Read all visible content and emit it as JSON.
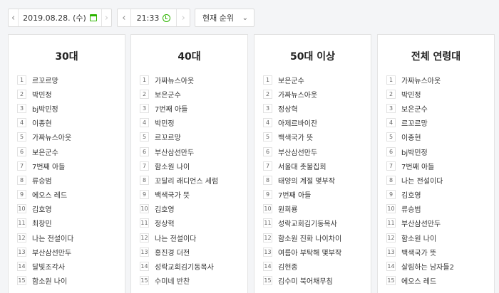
{
  "date_nav": {
    "date": "2019.08.28. (수)",
    "prev_icon": "chevron-left",
    "next_icon": "chevron-right",
    "calendar_icon": "calendar-icon"
  },
  "time_nav": {
    "time": "21:33",
    "prev_icon": "chevron-left",
    "next_icon": "chevron-right",
    "clock_icon": "clock-icon"
  },
  "sort_select": {
    "selected": "현재 순위"
  },
  "accent_color": "#2db400",
  "panels": [
    {
      "title": "30대",
      "items": [
        "르꼬르망",
        "박민정",
        "bj박민정",
        "이종현",
        "가짜뉴스아웃",
        "보은군수",
        "7번째 아들",
        "류승범",
        "에오스 레드",
        "김호영",
        "최창민",
        "나는 전설이다",
        "부산삼선만두",
        "달빛조각사",
        "함소원 나이"
      ]
    },
    {
      "title": "40대",
      "items": [
        "가짜뉴스아웃",
        "보은군수",
        "7번째 아들",
        "박민정",
        "르꼬르망",
        "부산삼선만두",
        "함소원 나이",
        "꼬달리 래디언스 세럼",
        "백색국가 뜻",
        "김호영",
        "정상혁",
        "나는 전설이다",
        "홍진경 더전",
        "성락교회김기동목사",
        "수미네 반찬"
      ]
    },
    {
      "title": "50대 이상",
      "items": [
        "보은군수",
        "가짜뉴스아웃",
        "정상혁",
        "아제르바이잔",
        "백색국가 뜻",
        "부산삼선만두",
        "서울대 촛불집회",
        "태양의 계절 몇부작",
        "7번째 아들",
        "원희룡",
        "성락교회김기동목사",
        "함소원 진화 나이차이",
        "여름아 부탁해 몇부작",
        "김현종",
        "김수미 북어채무침"
      ]
    },
    {
      "title": "전체 연령대",
      "items": [
        "가짜뉴스아웃",
        "박민정",
        "보은군수",
        "르꼬르망",
        "이종현",
        "bj박민정",
        "7번째 아들",
        "나는 전설이다",
        "김호영",
        "류승범",
        "부산삼선만두",
        "함소원 나이",
        "백색국가 뜻",
        "살림하는 남자들2",
        "에오스 레드"
      ]
    }
  ]
}
